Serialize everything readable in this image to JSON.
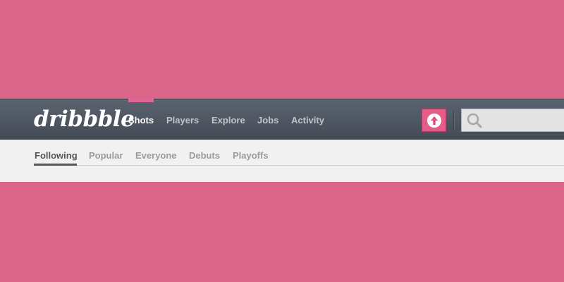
{
  "brand": {
    "logo_text": "dribbble"
  },
  "colors": {
    "background": "#dc6689",
    "accent": "#e45d88",
    "navbar": "#4e5662",
    "subnav": "#f1f1f1"
  },
  "nav": {
    "items": [
      {
        "label": "Shots",
        "active": true
      },
      {
        "label": "Players"
      },
      {
        "label": "Explore"
      },
      {
        "label": "Jobs"
      },
      {
        "label": "Activity"
      }
    ],
    "upload_icon": "upload-arrow-icon",
    "search": {
      "placeholder": "",
      "icon": "search-icon"
    }
  },
  "subnav": {
    "items": [
      {
        "label": "Following",
        "active": true
      },
      {
        "label": "Popular"
      },
      {
        "label": "Everyone"
      },
      {
        "label": "Debuts"
      },
      {
        "label": "Playoffs"
      }
    ]
  }
}
